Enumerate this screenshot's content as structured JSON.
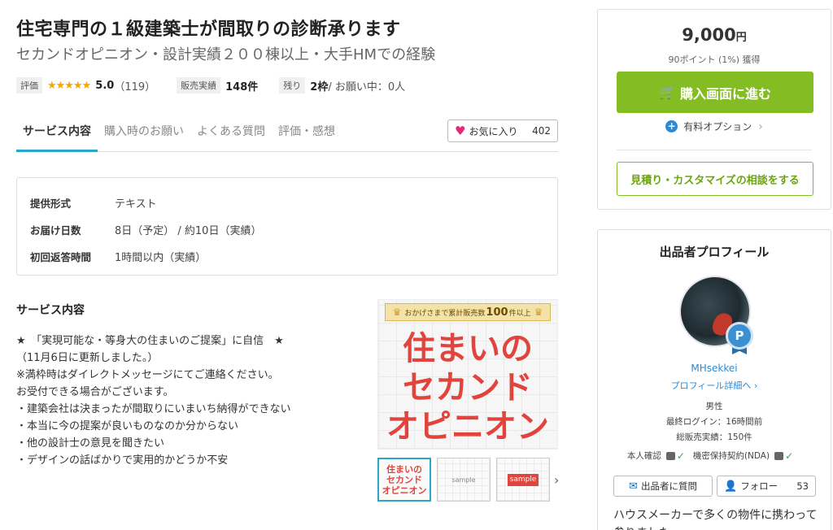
{
  "title": "住宅専門の１級建築士が間取りの診断承ります",
  "subtitle": "セカンドオピニオン・設計実績２００棟以上・大手HMでの経験",
  "meta": {
    "rating_label": "評価",
    "stars": "★★★★★",
    "rating": "5.0",
    "review_count": "（119）",
    "sales_label": "販売実績",
    "sales": "148件",
    "remaining_label": "残り",
    "remaining": "2枠",
    "in_progress": " / お願い中：0人"
  },
  "tabs": [
    "サービス内容",
    "購入時のお願い",
    "よくある質問",
    "評価・感想"
  ],
  "favorite": {
    "label": "お気に入り",
    "count": "402"
  },
  "spec": [
    {
      "key": "提供形式",
      "value": "テキスト"
    },
    {
      "key": "お届け日数",
      "value": "8日（予定） / 約10日（実績）"
    },
    {
      "key": "初回返答時間",
      "value": "1時間以内（実績）"
    }
  ],
  "description": {
    "heading": "サービス内容",
    "lines": [
      "★　「実現可能な・等身大の住まいのご提案」に自信　★",
      "（11月6日に更新しました。）",
      "",
      "※満枠時はダイレクトメッセージにてご連絡ください。",
      "お受付できる場合がございます。",
      "",
      "・建築会社は決まったが間取りにいまいち納得ができない",
      "・本当に今の提案が良いものなのか分からない",
      "・他の設計士の意見を聞きたい",
      "・デザインの話ばかりで実用的かどうか不安"
    ]
  },
  "hero": {
    "banner_pre": "おかげさまで累計販売数",
    "banner_num": "100",
    "banner_post": "件以上",
    "text_line1": "住まいの",
    "text_line2": "セカンド",
    "text_line3": "オピニオン"
  },
  "thumbs": {
    "t1_line1": "住まいの",
    "t1_line2": "セカンド",
    "t1_line3": "オピニオン",
    "sample": "sample"
  },
  "purchase": {
    "price": "9,000",
    "currency": "円",
    "points": "90ポイント (1%) 獲得",
    "buy_label": "購入画面に進む",
    "option_label": "有料オプション",
    "consult_label": "見積り・カスタマイズの相談をする"
  },
  "profile": {
    "heading": "出品者プロフィール",
    "badge": "P",
    "username": "MHsekkei",
    "detail_link": "プロフィール詳細へ ›",
    "gender": "男性",
    "last_login": "最終ログイン：16時間前",
    "total_sales": "総販売実績：150件",
    "identity": "本人確認",
    "nda": "機密保持契約(NDA)",
    "ask_label": "出品者に質問",
    "follow_label": "フォロー",
    "follow_count": "53",
    "bio": "ハウスメーカーで多くの物件に携わって参りました"
  },
  "colors": {
    "accent_blue": "#29a6c8",
    "buy_green": "#84bc24",
    "star": "#f2a900",
    "heart": "#e5297a",
    "hero_red": "#e0443c"
  }
}
